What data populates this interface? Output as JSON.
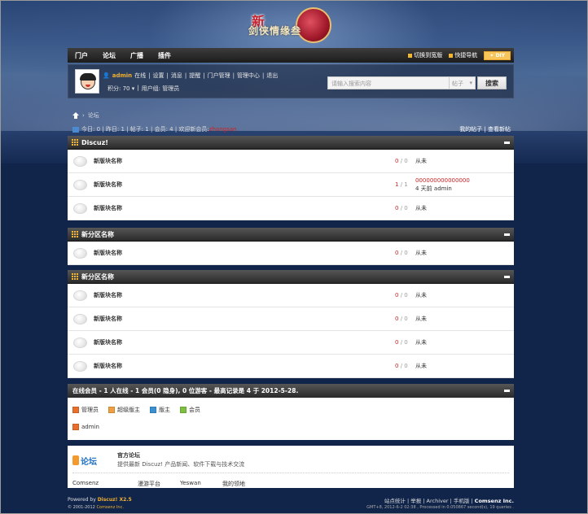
{
  "brand": {
    "logo_big": "新",
    "logo_name": "剑侠情缘叁"
  },
  "nav": {
    "items": [
      "门户",
      "论坛",
      "广播",
      "插件"
    ],
    "switch_width": "切换到宽版",
    "quick_nav": "快捷导航",
    "diy": "DIY"
  },
  "user": {
    "name": "admin",
    "online": "在线",
    "links": [
      "设置",
      "消息",
      "提醒",
      "门户管理",
      "管理中心",
      "退出"
    ],
    "points": "积分: 70",
    "group": "用户组: 管理员"
  },
  "search": {
    "placeholder": "请输入搜索内容",
    "scope": "帖子",
    "button": "搜索"
  },
  "breadcrumb": {
    "current": "论坛"
  },
  "stats": {
    "today": "今日: 0",
    "yesterday": "昨日: 1",
    "posts": "帖子: 1",
    "members": "会员: 4",
    "welcome": "欢迎新会员: ",
    "new_member": "zhangsan",
    "my_posts": "我的帖子",
    "new_posts": "查看新帖"
  },
  "sections": [
    {
      "title": "Discuz!",
      "forums": [
        {
          "name": "新版块名称",
          "threads": "0",
          "posts": "0",
          "last": "从未",
          "last_time": ""
        },
        {
          "name": "新版块名称",
          "threads": "1",
          "posts": "1",
          "last": "000000000000000",
          "last_time": "4 天前 admin"
        },
        {
          "name": "新版块名称",
          "threads": "0",
          "posts": "0",
          "last": "从未",
          "last_time": ""
        }
      ]
    },
    {
      "title": "新分区名称",
      "forums": [
        {
          "name": "新版块名称",
          "threads": "0",
          "posts": "0",
          "last": "从未",
          "last_time": ""
        }
      ]
    },
    {
      "title": "新分区名称",
      "forums": [
        {
          "name": "新版块名称",
          "threads": "0",
          "posts": "0",
          "last": "从未",
          "last_time": ""
        },
        {
          "name": "新版块名称",
          "threads": "0",
          "posts": "0",
          "last": "从未",
          "last_time": ""
        },
        {
          "name": "新版块名称",
          "threads": "0",
          "posts": "0",
          "last": "从未",
          "last_time": ""
        },
        {
          "name": "新版块名称",
          "threads": "0",
          "posts": "0",
          "last": "从未",
          "last_time": ""
        }
      ]
    }
  ],
  "online": {
    "title": "在线会员 - 1 人在线 - 1 会员(0 隐身), 0 位游客 - 最高记录是 4 于 2012-5-28.",
    "legend": [
      {
        "label": "管理员",
        "color": "#e8702a"
      },
      {
        "label": "超级版主",
        "color": "#f0a040"
      },
      {
        "label": "版主",
        "color": "#3a90d0"
      },
      {
        "label": "会员",
        "color": "#7cc040"
      }
    ],
    "user": "admin"
  },
  "links": {
    "logo": "论坛",
    "title": "官方论坛",
    "desc": "提供最新 Discuz! 产品新闻、软件下载与技术交流",
    "names": [
      "Comsenz",
      "漫游平台",
      "Yeswan",
      "我的领地"
    ]
  },
  "footer": {
    "powered": "Powered by ",
    "product": "Discuz! X2.5",
    "copyright": "© 2001-2012 ",
    "company": "Comsenz Inc.",
    "right_links": "站点统计 | 举报 | Archiver | 手机版 | ",
    "right_company": "Comsenz Inc.",
    "gmt": "GMT+8, 2012-6-2 02:38 , Processed in 0.050867 second(s), 19 queries ."
  }
}
